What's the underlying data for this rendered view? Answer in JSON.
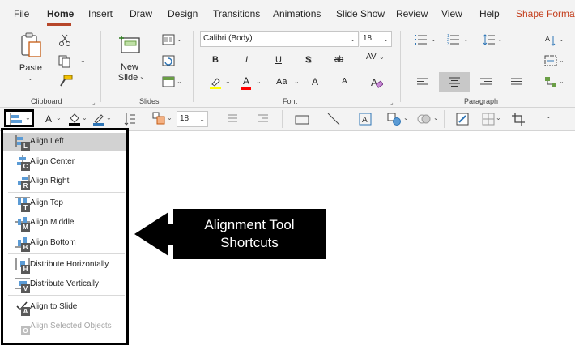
{
  "tabs": [
    "File",
    "Home",
    "Insert",
    "Draw",
    "Design",
    "Transitions",
    "Animations",
    "Slide Show",
    "Review",
    "View",
    "Help",
    "Shape Format"
  ],
  "ribbon": {
    "clipboard": {
      "label": "Clipboard",
      "paste_label": "Paste"
    },
    "slides": {
      "label": "Slides",
      "new_slide_line1": "New",
      "new_slide_line2": "Slide"
    },
    "font": {
      "label": "Font",
      "font_name": "Calibri (Body)",
      "font_size": "18",
      "bold": "B",
      "italic": "I",
      "underline": "U",
      "shadow": "S",
      "strike": "ab",
      "spacing": "AV",
      "font_color": "A",
      "change_case": "Aa",
      "grow": "A",
      "shrink": "A"
    },
    "paragraph": {
      "label": "Paragraph"
    }
  },
  "drawbar": {
    "font_size": "18"
  },
  "menu": {
    "items": [
      {
        "label": "Align Left",
        "key": "L"
      },
      {
        "label": "Align Center",
        "key": "C"
      },
      {
        "label": "Align Right",
        "key": "R"
      },
      {
        "label": "Align Top",
        "key": "T"
      },
      {
        "label": "Align Middle",
        "key": "M"
      },
      {
        "label": "Align Bottom",
        "key": "B"
      },
      {
        "label": "Distribute Horizontally",
        "key": "H"
      },
      {
        "label": "Distribute Vertically",
        "key": "V"
      },
      {
        "label": "Align to Slide",
        "key": "A"
      },
      {
        "label": "Align Selected Objects",
        "key": "O"
      }
    ]
  },
  "callout": {
    "line1": "Alignment Tool",
    "line2": "Shortcuts"
  },
  "colors": {
    "accent": "#c43e1c",
    "tab_underline": "#b7472a",
    "ribbon_bg": "#f3f3f3",
    "highlight_yellow": "#ffff00",
    "font_red": "#ff0000",
    "callout_bg": "#000000"
  }
}
